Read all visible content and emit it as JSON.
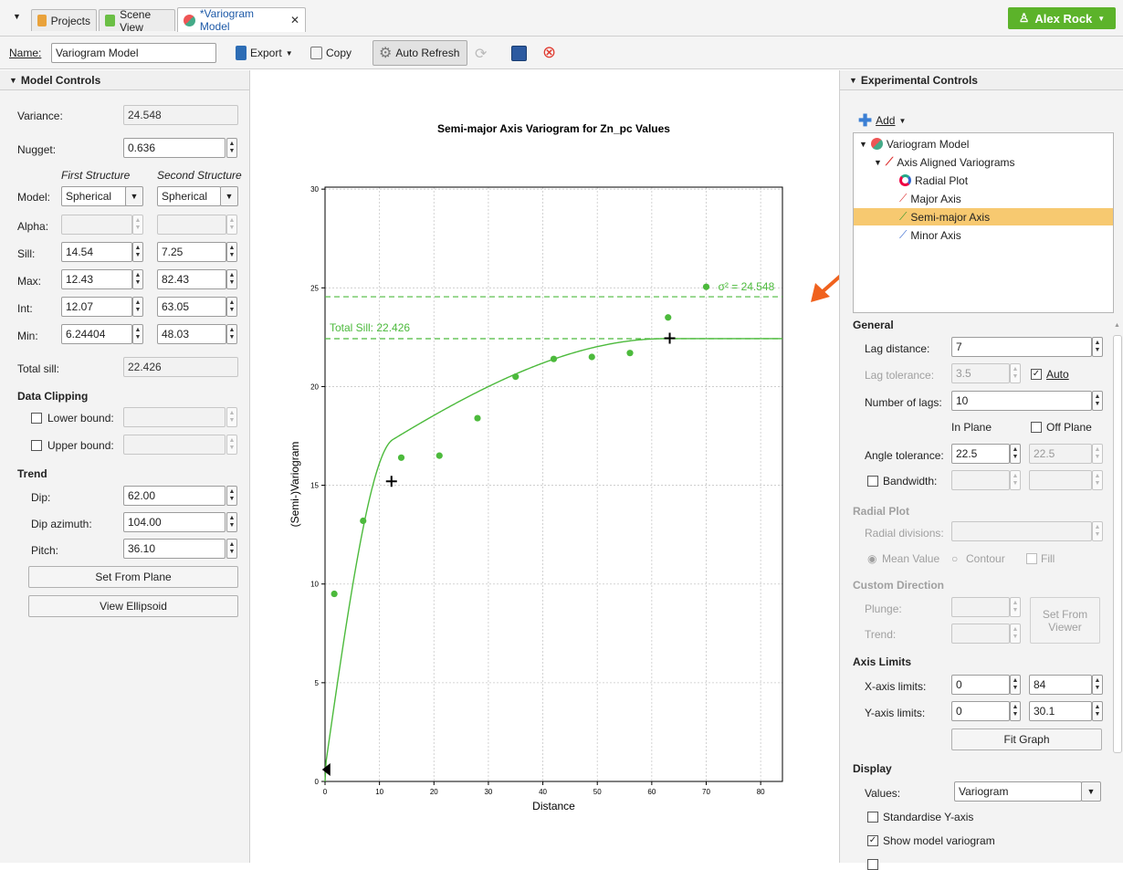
{
  "tabs": [
    {
      "label": "Projects"
    },
    {
      "label": "Scene View"
    },
    {
      "label": "*Variogram Model"
    }
  ],
  "user": {
    "name": "Alex Rock"
  },
  "toolbar": {
    "name_label": "Name:",
    "name_value": "Variogram Model",
    "export_label": "Export",
    "copy_label": "Copy",
    "auto_refresh_label": "Auto Refresh"
  },
  "model_controls": {
    "title": "Model Controls",
    "variance_label": "Variance:",
    "variance_value": "24.548",
    "nugget_label": "Nugget:",
    "nugget_value": "0.636",
    "first_structure": "First Structure",
    "second_structure": "Second Structure",
    "model_label": "Model:",
    "model_first": "Spherical",
    "model_second": "Spherical",
    "alpha_label": "Alpha:",
    "sill_label": "Sill:",
    "sill_first": "14.54",
    "sill_second": "7.25",
    "max_label": "Max:",
    "max_first": "12.43",
    "max_second": "82.43",
    "int_label": "Int:",
    "int_first": "12.07",
    "int_second": "63.05",
    "min_label": "Min:",
    "min_first": "6.24404",
    "min_second": "48.03",
    "total_sill_label": "Total sill:",
    "total_sill_value": "22.426",
    "data_clipping": "Data Clipping",
    "lower_bound": "Lower bound:",
    "upper_bound": "Upper bound:",
    "trend": "Trend",
    "dip_label": "Dip:",
    "dip_value": "62.00",
    "dip_azimuth_label": "Dip azimuth:",
    "dip_azimuth_value": "104.00",
    "pitch_label": "Pitch:",
    "pitch_value": "36.10",
    "set_from_plane": "Set From Plane",
    "view_ellipsoid": "View Ellipsoid"
  },
  "experimental_controls": {
    "title": "Experimental Controls",
    "add_label": "Add",
    "tree": [
      {
        "label": "Variogram Model"
      },
      {
        "label": "Axis Aligned Variograms"
      },
      {
        "label": "Radial Plot"
      },
      {
        "label": "Major Axis"
      },
      {
        "label": "Semi-major Axis"
      },
      {
        "label": "Minor Axis"
      }
    ],
    "general": "General",
    "lag_distance_label": "Lag distance:",
    "lag_distance_value": "7",
    "lag_tolerance_label": "Lag tolerance:",
    "lag_tolerance_value": "3.5",
    "auto_label": "Auto",
    "num_lags_label": "Number of lags:",
    "num_lags_value": "10",
    "in_plane": "In Plane",
    "off_plane": "Off Plane",
    "angle_tol_label": "Angle tolerance:",
    "angle_tol_value": "22.5",
    "angle_tol_off": "22.5",
    "bandwidth_label": "Bandwidth:",
    "radial_plot": "Radial Plot",
    "radial_divisions": "Radial divisions:",
    "mean_value": "Mean Value",
    "contour": "Contour",
    "fill": "Fill",
    "custom_direction": "Custom Direction",
    "plunge": "Plunge:",
    "trend": "Trend:",
    "set_from_viewer": "Set From Viewer",
    "axis_limits": "Axis Limits",
    "x_axis_limits": "X-axis limits:",
    "x_min": "0",
    "x_max": "84",
    "y_axis_limits": "Y-axis limits:",
    "y_min": "0",
    "y_max": "30.1",
    "fit_graph": "Fit Graph",
    "display": "Display",
    "values_label": "Values:",
    "values_value": "Variogram",
    "standardise": "Standardise Y-axis",
    "show_model": "Show model variogram"
  },
  "colors": {
    "accent_green": "#4cba3c",
    "arrow_orange": "#f0621e",
    "selection": "#f7c970",
    "user_button": "#5cb32a"
  },
  "chart_data": {
    "type": "scatter",
    "title": "Semi-major Axis Variogram for Zn_pc Values",
    "xlabel": "Distance",
    "ylabel": "(Semi-)Variogram",
    "xlim": [
      0,
      84
    ],
    "ylim": [
      0,
      30.1
    ],
    "xticks": [
      "0",
      "10",
      "20",
      "30",
      "40",
      "50",
      "60",
      "70",
      "80"
    ],
    "yticks": [
      "0",
      "5",
      "10",
      "15",
      "20",
      "25",
      "30"
    ],
    "grid": true,
    "series": [
      {
        "values_x": [
          1.7,
          7,
          14,
          21,
          28,
          35,
          42,
          49,
          56,
          63
        ],
        "values_y": [
          9.5,
          13.2,
          16.4,
          16.5,
          18.4,
          20.5,
          21.4,
          21.5,
          21.7,
          23.5
        ]
      }
    ],
    "model_curve": {
      "nugget": 0.636,
      "sill1": 14.54,
      "range1": 12.43,
      "sill2": 7.25,
      "range2": 62.43
    },
    "sill_lines": [
      {
        "label": "Total Sill: 22.426",
        "y": 22.426
      },
      {
        "label": "σ² = 24.548",
        "y": 24.548
      }
    ],
    "markers": [
      {
        "x": 12.2,
        "y": 15.2,
        "shape": "plus"
      },
      {
        "x": 63.3,
        "y": 22.45,
        "shape": "plus"
      },
      {
        "x": 0.3,
        "y": 0.6,
        "shape": "triangle"
      }
    ],
    "annotation_point": {
      "x": 70,
      "y": 25.05
    }
  }
}
